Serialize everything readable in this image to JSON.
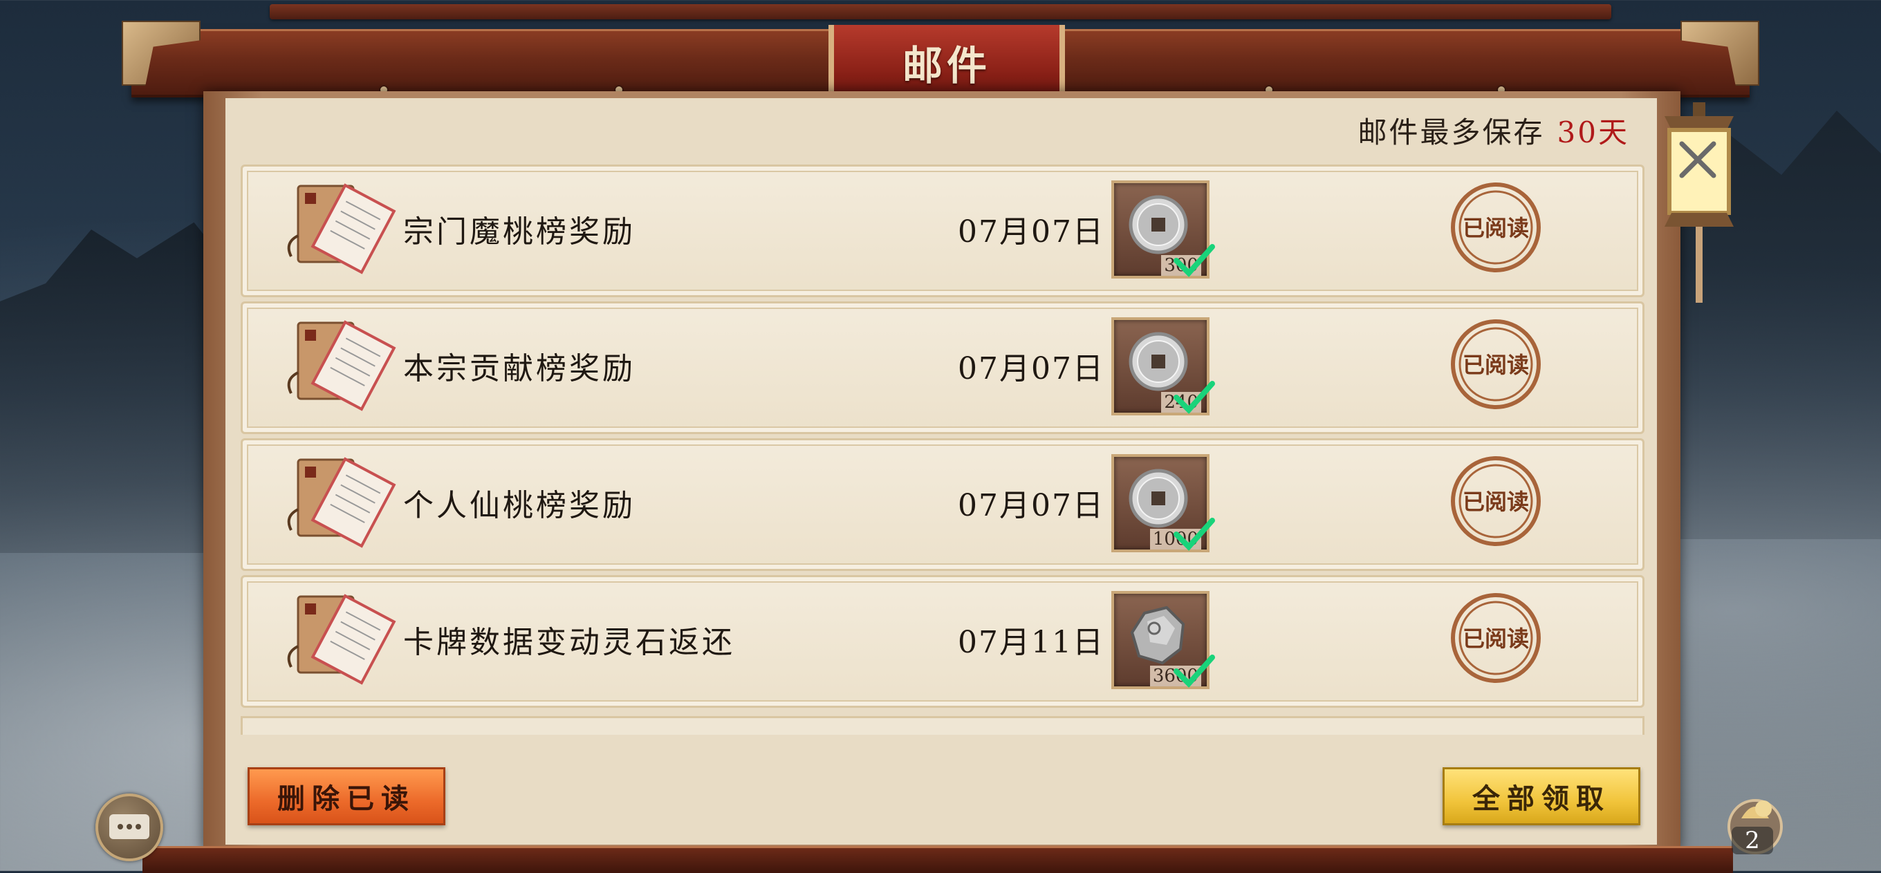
{
  "window": {
    "title": "邮件"
  },
  "retention": {
    "label": "邮件最多保存",
    "days": "30天"
  },
  "mails": [
    {
      "title": "宗门魔桃榜奖励",
      "date": "07月07日",
      "reward_item": "silver-coin-icon",
      "reward_qty": "300",
      "claimed": true,
      "status": "已阅读"
    },
    {
      "title": "本宗贡献榜奖励",
      "date": "07月07日",
      "reward_item": "silver-coin-icon",
      "reward_qty": "240",
      "claimed": true,
      "status": "已阅读"
    },
    {
      "title": "个人仙桃榜奖励",
      "date": "07月07日",
      "reward_item": "silver-coin-icon",
      "reward_qty": "1000",
      "claimed": true,
      "status": "已阅读"
    },
    {
      "title": "卡牌数据变动灵石返还",
      "date": "07月11日",
      "reward_item": "spirit-stone-icon",
      "reward_qty": "3600",
      "claimed": true,
      "status": "已阅读"
    }
  ],
  "buttons": {
    "delete_read": "删除已读",
    "claim_all": "全部领取"
  },
  "bag": {
    "count": "2"
  },
  "colors": {
    "accent_red": "#b01a1a",
    "check_green": "#19d37a",
    "panel_bg": "#e8dcc5"
  }
}
